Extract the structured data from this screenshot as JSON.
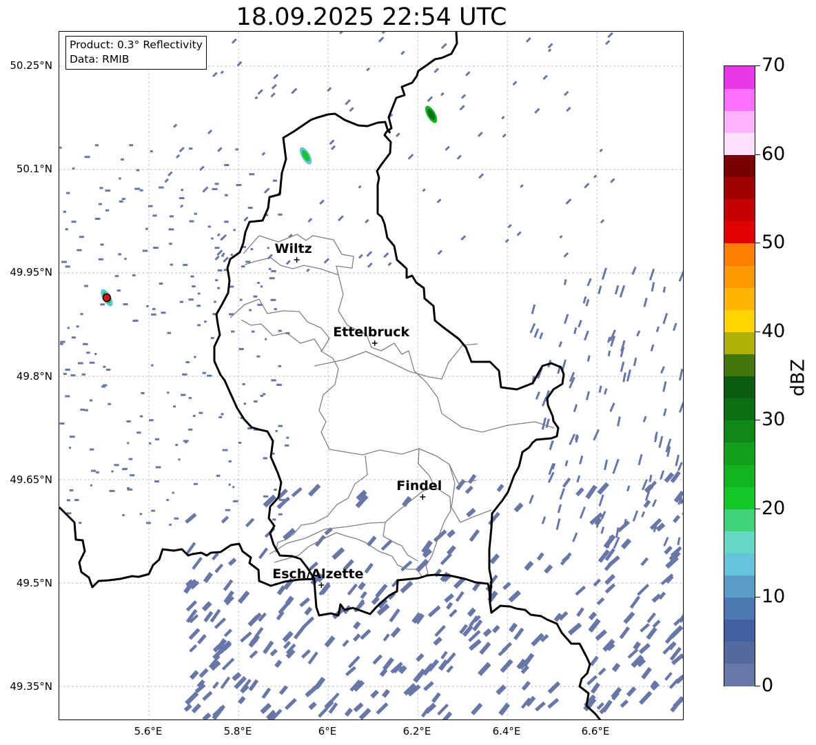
{
  "title": "18.09.2025 22:54 UTC",
  "info_box": {
    "product": "Product: 0.3° Reflectivity",
    "data": "Data: RMIB"
  },
  "lat_labels": [
    "50.25°N",
    "50.1°N",
    "49.95°N",
    "49.8°N",
    "49.65°N",
    "49.5°N",
    "49.35°N"
  ],
  "lon_labels": [
    "5.6°E",
    "5.8°E",
    "6°E",
    "6.2°E",
    "6.4°E",
    "6.6°E"
  ],
  "cities": [
    {
      "name": "Wiltz",
      "lon": 5.93,
      "lat": 49.969
    },
    {
      "name": "Ettelbruck",
      "lon": 6.104,
      "lat": 49.848
    },
    {
      "name": "Findel",
      "lon": 6.211,
      "lat": 49.625
    },
    {
      "name": "Esch/Alzette",
      "lon": 5.985,
      "lat": 49.497
    }
  ],
  "radar_site": {
    "lon": 5.506,
    "lat": 49.914,
    "color": "#e01010"
  },
  "colorbar": {
    "label": "dBZ",
    "min": 0,
    "max": 70,
    "tick_labels": [
      "0",
      "10",
      "20",
      "30",
      "40",
      "50",
      "60",
      "70"
    ],
    "colors": [
      "#6677a8",
      "#54699f",
      "#445fa0",
      "#4b7ab3",
      "#5a9ec8",
      "#66c3dc",
      "#64d8c5",
      "#40d47a",
      "#12c828",
      "#12b520",
      "#11a01b",
      "#0f8818",
      "#0b7014",
      "#095c10",
      "#43760d",
      "#afb106",
      "#ffd500",
      "#ffb400",
      "#ff9900",
      "#ff7f00",
      "#e30000",
      "#c40000",
      "#a00000",
      "#7a0000",
      "#ffe1ff",
      "#ffb3ff",
      "#ff6eff",
      "#e838e8"
    ]
  },
  "map": {
    "extent": {
      "lon_min": 5.4,
      "lon_max": 6.795,
      "lat_min": 49.3,
      "lat_max": 50.3
    },
    "precip_color": "#6677a8",
    "cells": [
      {
        "lon": 6.23,
        "lat": 50.18,
        "dbz": 32
      },
      {
        "lon": 5.95,
        "lat": 50.12,
        "dbz": 22
      },
      {
        "lon": 5.506,
        "lat": 49.914,
        "dbz": 20
      }
    ]
  }
}
